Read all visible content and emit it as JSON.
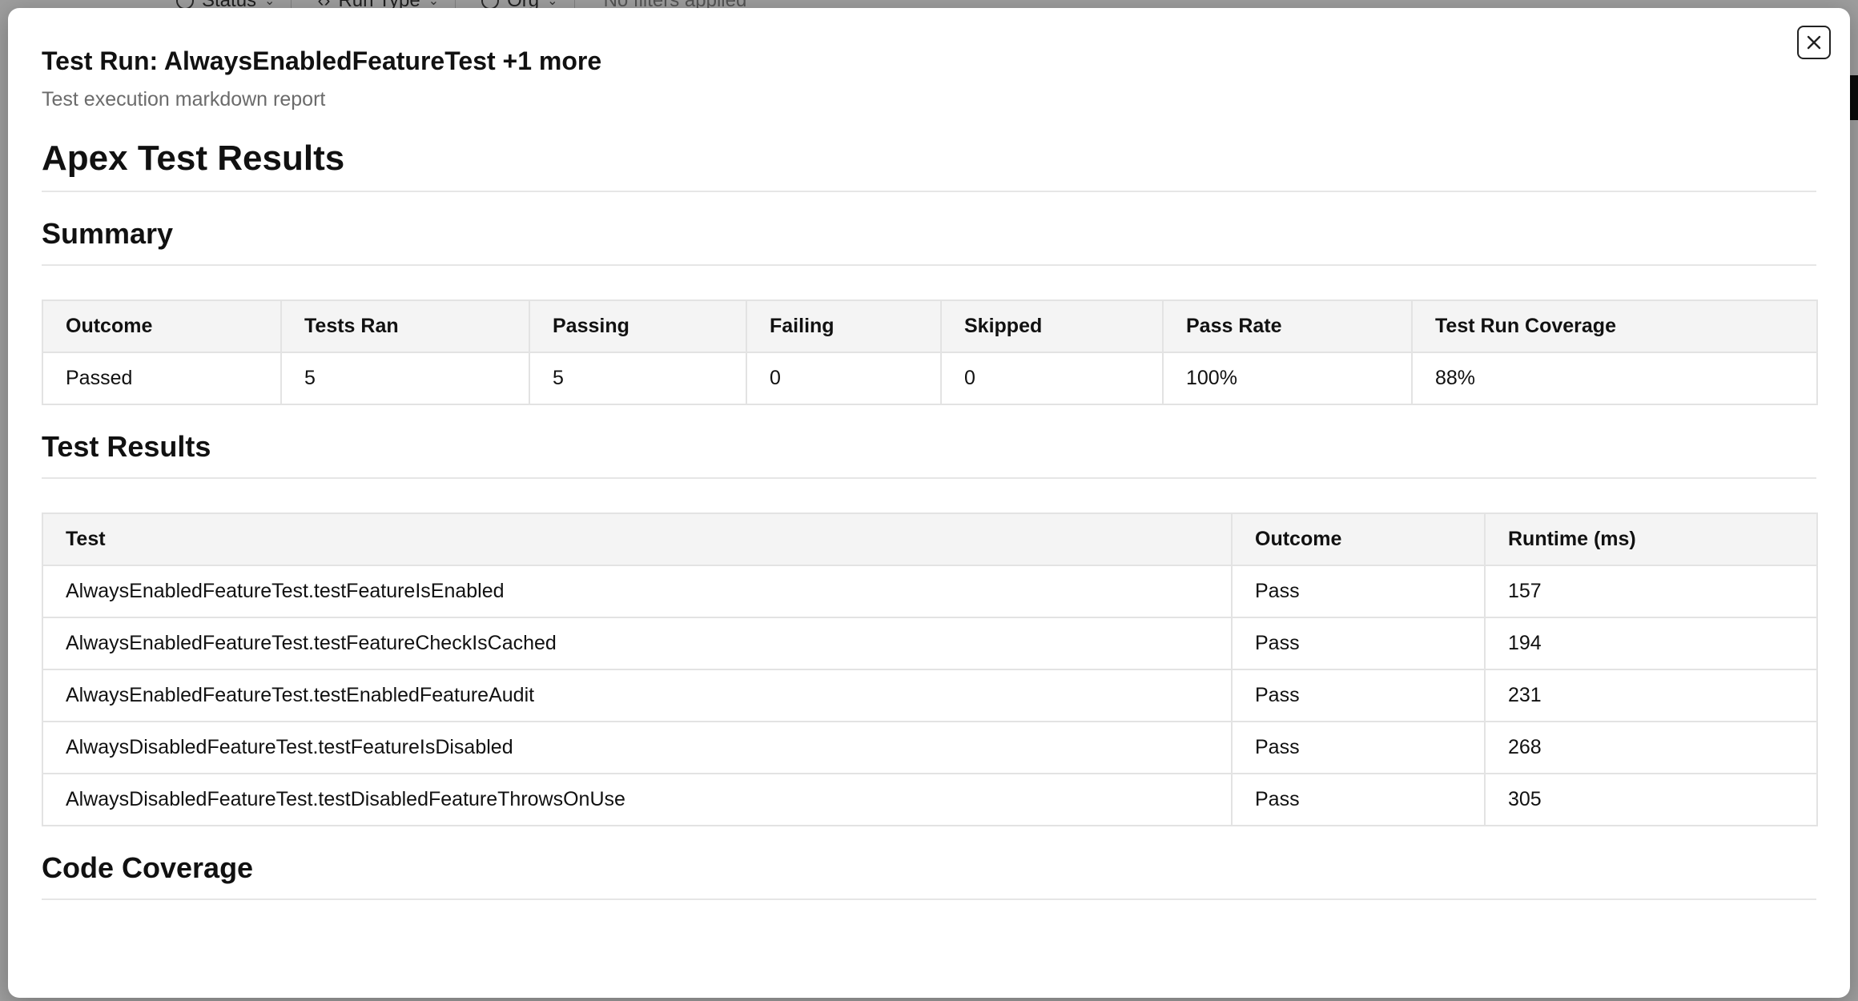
{
  "background": {
    "toolbar": {
      "chips": [
        {
          "label": "Status",
          "icon": "status-icon"
        },
        {
          "label": "Run Type",
          "icon": "code-icon"
        },
        {
          "label": "Org",
          "icon": "user-icon"
        }
      ],
      "no_filters": "No filters applied"
    }
  },
  "modal": {
    "title": "Test Run: AlwaysEnabledFeatureTest +1 more",
    "subtitle": "Test execution markdown report",
    "close_icon": "close-icon"
  },
  "report": {
    "heading": "Apex Test Results",
    "summary": {
      "heading": "Summary",
      "columns": [
        "Outcome",
        "Tests Ran",
        "Passing",
        "Failing",
        "Skipped",
        "Pass Rate",
        "Test Run Coverage"
      ],
      "rows": [
        [
          "Passed",
          "5",
          "5",
          "0",
          "0",
          "100%",
          "88%"
        ]
      ]
    },
    "test_results": {
      "heading": "Test Results",
      "columns": [
        "Test",
        "Outcome",
        "Runtime (ms)"
      ],
      "rows": [
        [
          "AlwaysEnabledFeatureTest.testFeatureIsEnabled",
          "Pass",
          "157"
        ],
        [
          "AlwaysEnabledFeatureTest.testFeatureCheckIsCached",
          "Pass",
          "194"
        ],
        [
          "AlwaysEnabledFeatureTest.testEnabledFeatureAudit",
          "Pass",
          "231"
        ],
        [
          "AlwaysDisabledFeatureTest.testFeatureIsDisabled",
          "Pass",
          "268"
        ],
        [
          "AlwaysDisabledFeatureTest.testDisabledFeatureThrowsOnUse",
          "Pass",
          "305"
        ]
      ]
    },
    "code_coverage": {
      "heading": "Code Coverage"
    }
  }
}
